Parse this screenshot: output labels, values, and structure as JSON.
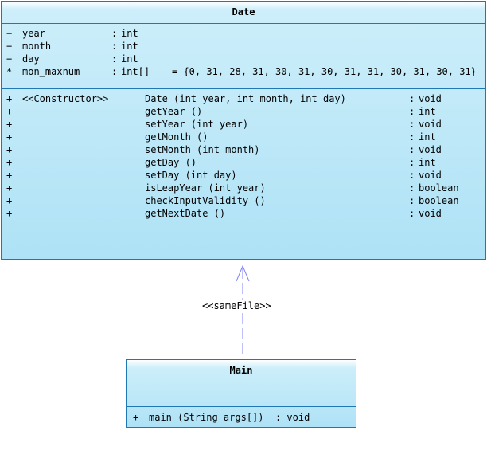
{
  "date_class": {
    "name": "Date",
    "attributes": [
      {
        "visibility": "−",
        "name": "year",
        "type": "int",
        "init": ""
      },
      {
        "visibility": "−",
        "name": "month",
        "type": "int",
        "init": ""
      },
      {
        "visibility": "−",
        "name": "day",
        "type": "int",
        "init": ""
      },
      {
        "visibility": "*",
        "name": "mon_maxnum",
        "type": "int[]",
        "init": "= {0, 31, 28, 31, 30, 31, 30, 31, 31, 30, 31, 30, 31}"
      }
    ],
    "operations": [
      {
        "visibility": "+",
        "stereotype": "<<Constructor>>",
        "signature": "Date (int year, int month, int day)",
        "returns": "void"
      },
      {
        "visibility": "+",
        "stereotype": "",
        "signature": "getYear ()",
        "returns": "int"
      },
      {
        "visibility": "+",
        "stereotype": "",
        "signature": "setYear (int year)",
        "returns": "void"
      },
      {
        "visibility": "+",
        "stereotype": "",
        "signature": "getMonth ()",
        "returns": "int"
      },
      {
        "visibility": "+",
        "stereotype": "",
        "signature": "setMonth (int month)",
        "returns": "void"
      },
      {
        "visibility": "+",
        "stereotype": "",
        "signature": "getDay ()",
        "returns": "int"
      },
      {
        "visibility": "+",
        "stereotype": "",
        "signature": "setDay (int day)",
        "returns": "void"
      },
      {
        "visibility": "+",
        "stereotype": "",
        "signature": "isLeapYear (int year)",
        "returns": "boolean"
      },
      {
        "visibility": "+",
        "stereotype": "",
        "signature": "checkInputValidity ()",
        "returns": "boolean"
      },
      {
        "visibility": "+",
        "stereotype": "",
        "signature": "getNextDate ()",
        "returns": "void"
      }
    ]
  },
  "main_class": {
    "name": "Main",
    "operations": [
      {
        "visibility": "+",
        "signature": "main (String args[])",
        "returns": "void"
      }
    ]
  },
  "dependency": {
    "label": "<<sameFile>>",
    "line_color": "#8080ff"
  },
  "colors": {
    "border": "#1f78b4",
    "fill": "#aee2f6"
  }
}
